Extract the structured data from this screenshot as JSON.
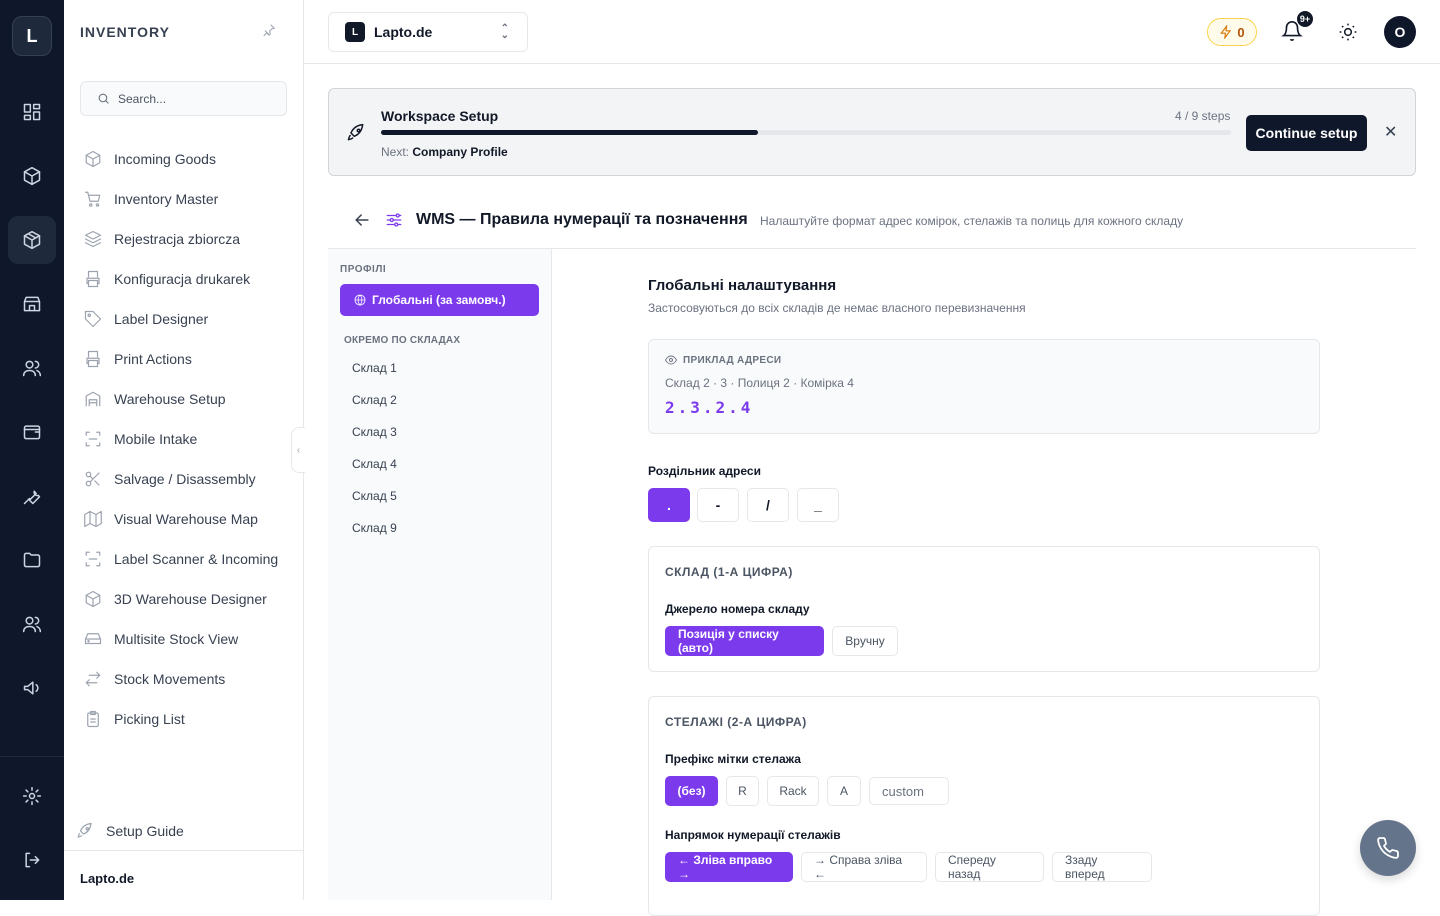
{
  "rail": {
    "logo": "L"
  },
  "sidebar": {
    "title": "INVENTORY",
    "search_placeholder": "Search...",
    "items": [
      {
        "label": "Incoming Goods",
        "icon": "package-icon"
      },
      {
        "label": "Inventory Master",
        "icon": "cart-icon"
      },
      {
        "label": "Rejestracja zbiorcza",
        "icon": "layers-icon"
      },
      {
        "label": "Konfiguracja drukarek",
        "icon": "printer-icon"
      },
      {
        "label": "Label Designer",
        "icon": "tag-icon"
      },
      {
        "label": "Print Actions",
        "icon": "printer-icon"
      },
      {
        "label": "Warehouse Setup",
        "icon": "building-icon"
      },
      {
        "label": "Mobile Intake",
        "icon": "scan-icon"
      },
      {
        "label": "Salvage / Disassembly",
        "icon": "scissors-icon"
      },
      {
        "label": "Visual Warehouse Map",
        "icon": "map-icon"
      },
      {
        "label": "Label Scanner & Incoming",
        "icon": "scan-icon"
      },
      {
        "label": "3D Warehouse Designer",
        "icon": "cube-icon"
      },
      {
        "label": "Multisite Stock View",
        "icon": "drive-icon"
      },
      {
        "label": "Stock Movements",
        "icon": "arrows-icon"
      },
      {
        "label": "Picking List",
        "icon": "clipboard-icon"
      }
    ],
    "setup_guide": "Setup Guide",
    "footer": "Lapto.de"
  },
  "topbar": {
    "workspace_badge": "L",
    "workspace_name": "Lapto.de",
    "credits": "0",
    "notifications_badge": "9+",
    "avatar": "O"
  },
  "setup": {
    "title": "Workspace Setup",
    "steps": "4 / 9 steps",
    "progress": 0.444,
    "next_prefix": "Next:",
    "next": "Company Profile",
    "button": "Continue setup"
  },
  "header": {
    "title": "WMS — Правила нумерації та позначення",
    "subtitle": "Налаштуйте формат адрес комірок, стелажів та полиць для кожного складу"
  },
  "profiles": {
    "label": "ПРОФІЛІ",
    "global": "Глобальні (за замовч.)",
    "per_warehouse_label": "ОКРЕМО ПО СКЛАДАХ",
    "warehouses": [
      "Склад 1",
      "Склад 2",
      "Склад 3",
      "Склад 4",
      "Склад 5",
      "Склад 9"
    ]
  },
  "main": {
    "title": "Глобальні налаштування",
    "subtitle": "Застосовуються до всіх складів де немає власного перевизначення",
    "example": {
      "label": "ПРИКЛАД АДРЕСИ",
      "description": "Склад 2 · 3 · Полиця 2 · Комірка 4",
      "value": "2.3.2.4"
    },
    "separator": {
      "label": "Роздільник адреси",
      "options": [
        ".",
        "-",
        "/",
        "_"
      ],
      "selected": "."
    },
    "warehouse_card": {
      "title": "СКЛАД (1-А ЦИФРА)",
      "source_label": "Джерело номера складу",
      "options": [
        "Позиція у списку (авто)",
        "Вручну"
      ],
      "selected": "Позиція у списку (авто)"
    },
    "racks_card": {
      "title": "СТЕЛАЖІ (2-А ЦИФРА)",
      "prefix_label": "Префікс мітки стелажа",
      "prefix_options": [
        "(без)",
        "R",
        "Rack",
        "A"
      ],
      "prefix_selected": "(без)",
      "custom_placeholder": "custom",
      "direction_label": "Напрямок нумерації стелажів",
      "direction_options": [
        "← Зліва вправо →",
        "→ Справа зліва ←",
        "Спереду назад",
        "Ззаду вперед"
      ],
      "direction_selected": "← Зліва вправо →"
    }
  },
  "colors": {
    "accent": "#7c3aed",
    "dark": "#0f172a",
    "warning": "#d97706"
  }
}
